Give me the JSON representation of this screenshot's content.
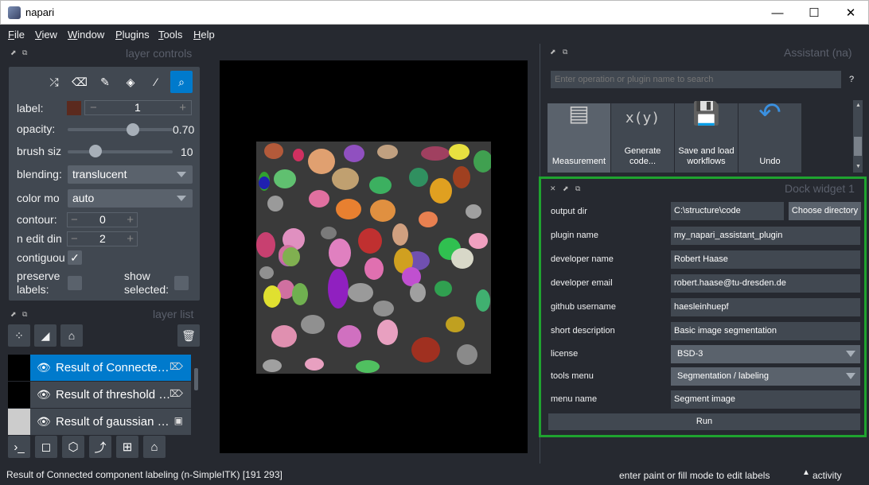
{
  "window": {
    "title": "napari",
    "minimize": "—",
    "maximize": "☐",
    "close": "✕"
  },
  "menu": [
    "File",
    "View",
    "Window",
    "Plugins",
    "Tools",
    "Help"
  ],
  "layer_controls": {
    "header": "layer controls",
    "label_label": "label:",
    "label_value": "1",
    "opacity_label": "opacity:",
    "opacity_value": "0.70",
    "brush_label": "brush siz",
    "brush_value": "10",
    "blending_label": "blending:",
    "blending_value": "translucent",
    "color_mode_label": "color mo",
    "color_mode_value": "auto",
    "contour_label": "contour:",
    "contour_value": "0",
    "n_edit_label": "n edit din",
    "n_edit_value": "2",
    "contiguous_label": "contiguou",
    "preserve_label": "preserve labels:",
    "show_selected_label": "show selected:",
    "label_color": "#5b2a1e",
    "accent": "#007acc",
    "opacity_fraction": 0.7,
    "brush_fraction": 0.22
  },
  "layer_list": {
    "header": "layer list",
    "layers": [
      {
        "name": "Result of Connected component labeling",
        "icon": "tag-icon"
      },
      {
        "name": "Result of threshold otsu",
        "icon": "tag-icon"
      },
      {
        "name": "Result of gaussian blur",
        "icon": "image-icon"
      }
    ]
  },
  "assistant": {
    "header": "Assistant (na)",
    "search_placeholder": "Enter operation or plugin name to search",
    "help": "?",
    "tiles": [
      {
        "label": "Measurement",
        "icon": "measurement-icon"
      },
      {
        "label": "Generate code...",
        "icon": "code-icon",
        "symbol": "x(y)"
      },
      {
        "label": "Save and load workflows",
        "icon": "save-icon"
      },
      {
        "label": "Undo",
        "icon": "undo-icon"
      }
    ]
  },
  "dock_widget": {
    "header": "Dock widget 1",
    "highlight_color": "#1fa32f",
    "output_dir_label": "output dir",
    "output_dir_value": "C:\\structure\\code",
    "choose_button": "Choose directory",
    "plugin_name_label": "plugin name",
    "plugin_name_value": "my_napari_assistant_plugin",
    "developer_name_label": "developer name",
    "developer_name_value": "Robert Haase",
    "developer_email_label": "developer email",
    "developer_email_value": "robert.haase@tu-dresden.de",
    "github_label": "github username",
    "github_value": "haesleinhuepf",
    "description_label": "short description",
    "description_value": "Basic image segmentation",
    "license_label": "license",
    "license_value": "BSD-3",
    "tools_menu_label": "tools menu",
    "tools_menu_value": "Segmentation / labeling",
    "menu_name_label": "menu name",
    "menu_name_value": "Segment image",
    "run_button": "Run"
  },
  "status": {
    "left": "Result of Connected component labeling (n-SimpleITK) [191 293]",
    "right": "enter paint or fill mode to edit labels",
    "activity": "activity"
  }
}
